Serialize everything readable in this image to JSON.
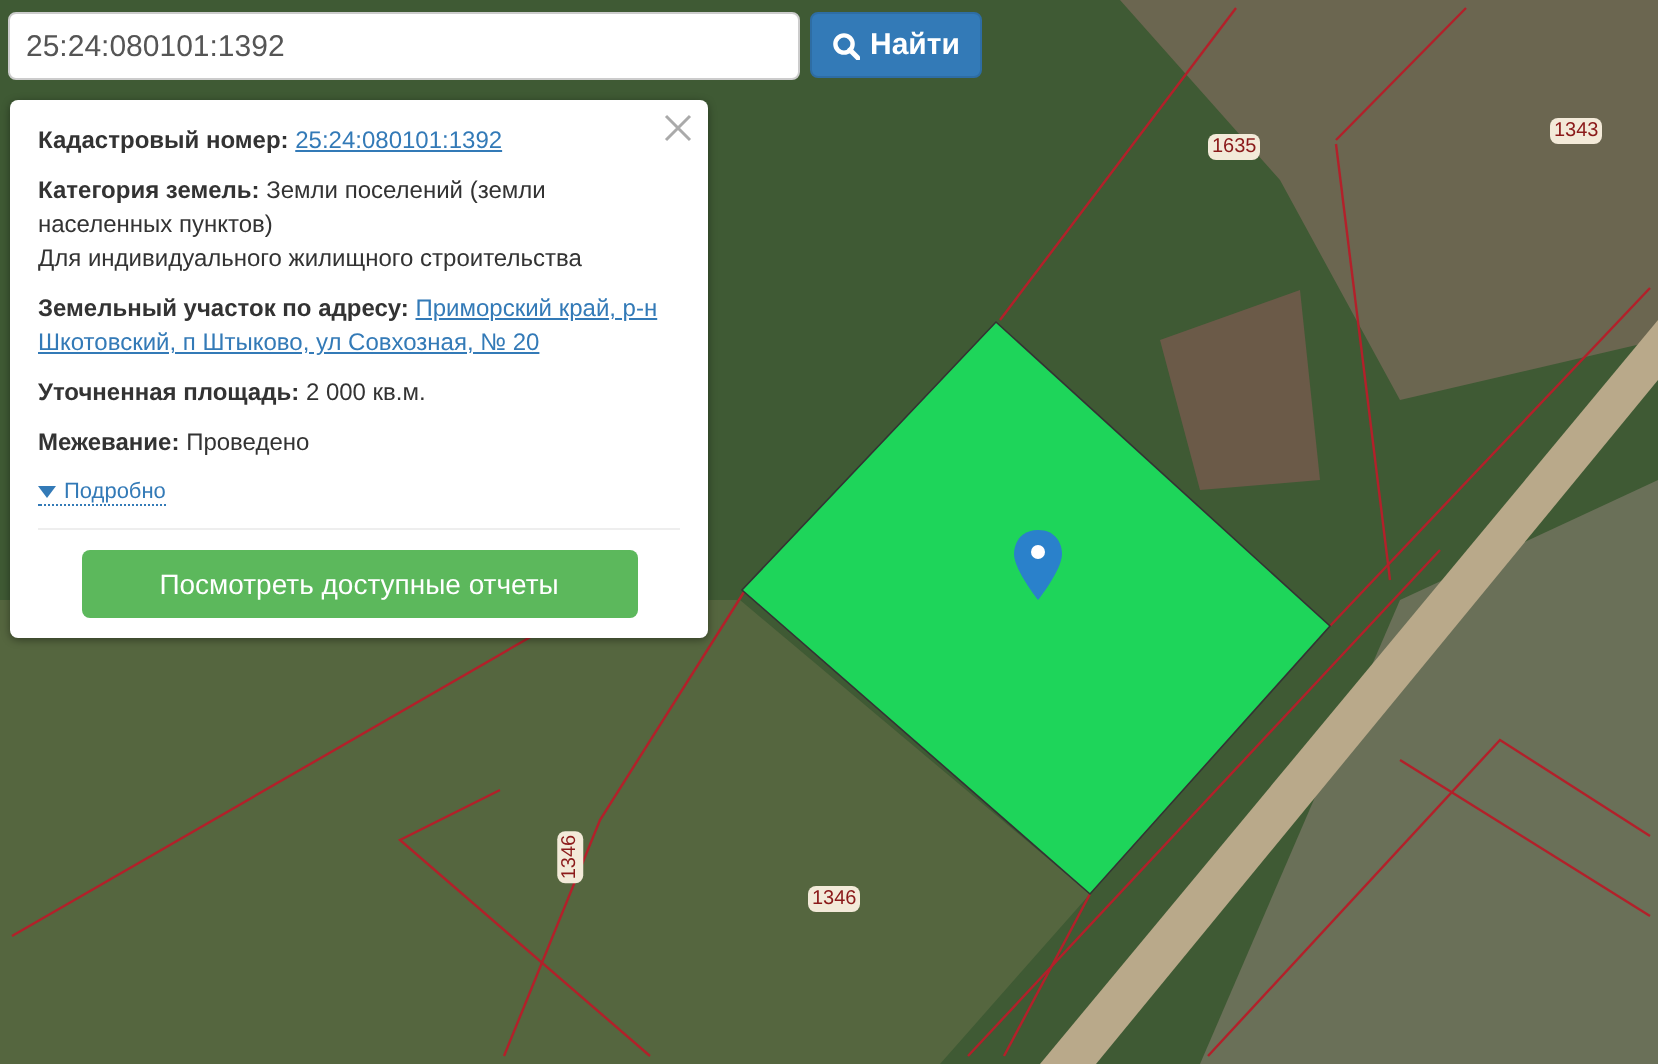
{
  "search": {
    "value": "25:24:080101:1392",
    "button": "Найти"
  },
  "popup": {
    "fields": [
      {
        "kind": "link",
        "label": "Кадастровый номер:",
        "value": "25:24:080101:1392"
      },
      {
        "kind": "text",
        "label": "Категория земель:",
        "value": "Земли поселений (земли населенных пунктов)",
        "note": "Для индивидуального жилищного строительства"
      },
      {
        "kind": "link",
        "label": "Земельный участок по адресу:",
        "value": "Приморский край, р-н Шкотовский, п Штыково, ул Совхозная, № 20"
      },
      {
        "kind": "text",
        "label": "Уточненная площадь:",
        "value": "2 000 кв.м."
      },
      {
        "kind": "text",
        "label": "Межевание:",
        "value": "Проведено"
      }
    ],
    "details": {
      "label": "Подробно",
      "expanded": false
    },
    "action": "Посмотреть доступные отчеты"
  },
  "map": {
    "parcel_labels": [
      {
        "text": "1635"
      },
      {
        "text": "1343"
      },
      {
        "text": "1346"
      },
      {
        "text": "1346"
      }
    ]
  }
}
